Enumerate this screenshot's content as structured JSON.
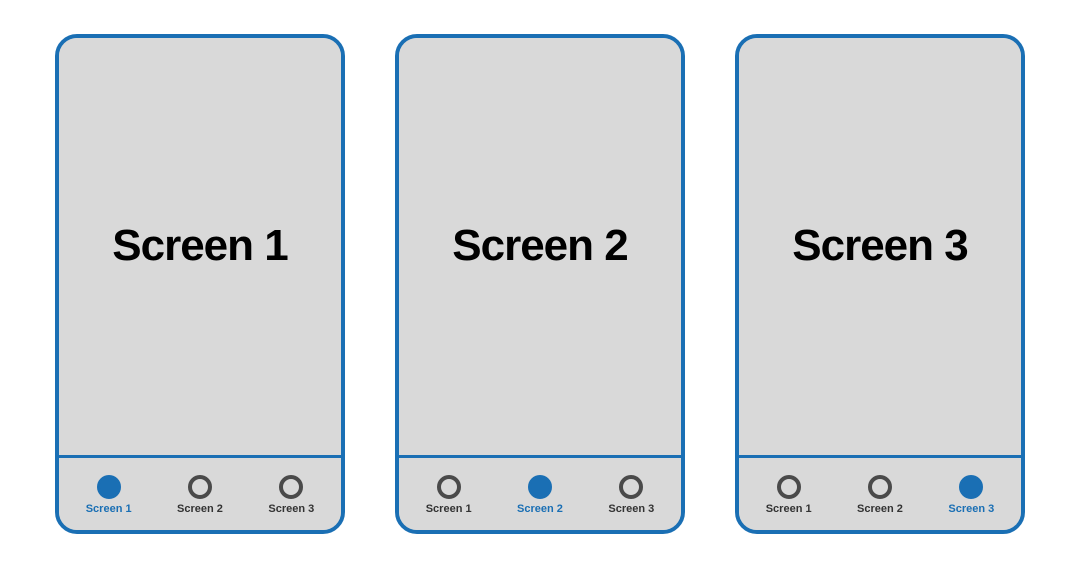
{
  "accent_color": "#1a6fb4",
  "phones": [
    {
      "title": "Screen 1",
      "tabs": [
        {
          "label": "Screen 1",
          "active": true
        },
        {
          "label": "Screen 2",
          "active": false
        },
        {
          "label": "Screen 3",
          "active": false
        }
      ]
    },
    {
      "title": "Screen 2",
      "tabs": [
        {
          "label": "Screen 1",
          "active": false
        },
        {
          "label": "Screen 2",
          "active": true
        },
        {
          "label": "Screen 3",
          "active": false
        }
      ]
    },
    {
      "title": "Screen 3",
      "tabs": [
        {
          "label": "Screen 1",
          "active": false
        },
        {
          "label": "Screen 2",
          "active": false
        },
        {
          "label": "Screen 3",
          "active": true
        }
      ]
    }
  ]
}
